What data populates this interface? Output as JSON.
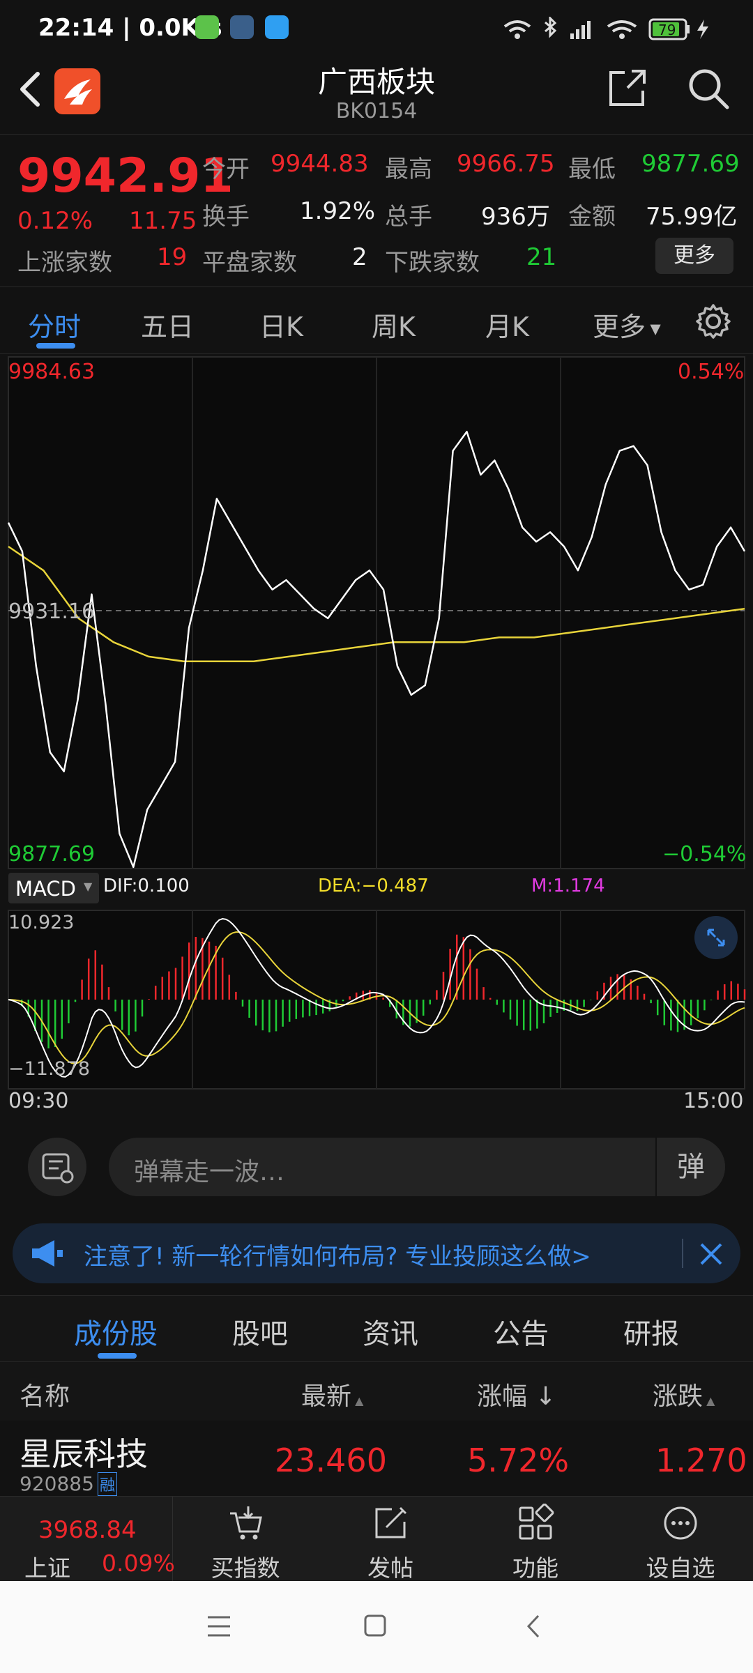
{
  "status_bar": {
    "time_speed": "22:14 | 0.0K/s",
    "battery": "79"
  },
  "header": {
    "title": "广西板块",
    "code": "BK0154"
  },
  "quote": {
    "price": "9942.91",
    "change_pct": "0.12%",
    "change": "11.75",
    "open_label": "今开",
    "open": "9944.83",
    "high_label": "最高",
    "high": "9966.75",
    "low_label": "最低",
    "low": "9877.69",
    "turnover_label": "换手",
    "turnover": "1.92%",
    "volume_label": "总手",
    "volume": "936万",
    "amount_label": "金额",
    "amount": "75.99亿",
    "up_label": "上涨家数",
    "up": "19",
    "flat_label": "平盘家数",
    "flat": "2",
    "down_label": "下跌家数",
    "down": "21",
    "more_button": "更多"
  },
  "tabs": {
    "intraday": "分时",
    "five_day": "五日",
    "daily": "日K",
    "weekly": "周K",
    "monthly": "月K",
    "more": "更多"
  },
  "chart": {
    "price_high": "9984.63",
    "price_mid": "9931.16",
    "price_low": "9877.69",
    "pct_high": "0.54%",
    "pct_low": "−0.54%",
    "indicator": "MACD",
    "dif": "DIF:0.100",
    "dea": "DEA:−0.487",
    "m": "M:1.174",
    "macd_high": "10.923",
    "macd_low": "−11.878",
    "time_start": "09:30",
    "time_end": "15:00",
    "colors": {
      "price_line": "#ffffff",
      "avg_line": "#e8d43a",
      "up": "#f0272c",
      "down": "#1fcb35"
    }
  },
  "chart_data": {
    "type": "line",
    "title": "",
    "ylim": [
      9877.69,
      9984.63
    ],
    "x_range": [
      "09:30",
      "15:00"
    ],
    "series": [
      {
        "values": [
          9950,
          9944,
          9920,
          9902,
          9898,
          9913,
          9935,
          9912,
          9885,
          9878,
          9890,
          9895,
          9900,
          9928,
          9940,
          9955,
          9950,
          9945,
          9940,
          9936,
          9938,
          9935,
          9932,
          9930,
          9934,
          9938,
          9940,
          9936,
          9920,
          9914,
          9916,
          9930,
          9965,
          9969,
          9960,
          9963,
          9957,
          9949,
          9946,
          9948,
          9945,
          9940,
          9947,
          9958,
          9965,
          9966,
          9962,
          9948,
          9940,
          9936,
          9937,
          9945,
          9949,
          9944
        ]
      },
      {
        "values": [
          9945,
          9940,
          9930,
          9925,
          9922,
          9921,
          9921,
          9921,
          9922,
          9923,
          9924,
          9925,
          9925,
          9925,
          9926,
          9926,
          9927,
          9928,
          9929,
          9930,
          9931,
          9932
        ]
      }
    ]
  },
  "chat": {
    "placeholder": "弹幕走一波…",
    "send_label": "弹"
  },
  "notice": {
    "text": "注意了! 新一轮行情如何布局? 专业投顾这么做>"
  },
  "section_tabs": [
    "成份股",
    "股吧",
    "资讯",
    "公告",
    "研报"
  ],
  "table": {
    "headers": {
      "name": "名称",
      "latest": "最新",
      "change_pct": "涨幅 ↓",
      "change": "涨跌"
    },
    "rows": [
      {
        "name": "星辰科技",
        "code": "920885",
        "tag": "融",
        "latest": "23.460",
        "change_pct": "5.72%",
        "change": "1.270"
      }
    ]
  },
  "bottom_nav": {
    "index_value": "3968.84",
    "index_name": "上证",
    "index_change": "0.09%",
    "buy_index": "买指数",
    "post": "发帖",
    "functions": "功能",
    "add_watch": "设自选"
  }
}
